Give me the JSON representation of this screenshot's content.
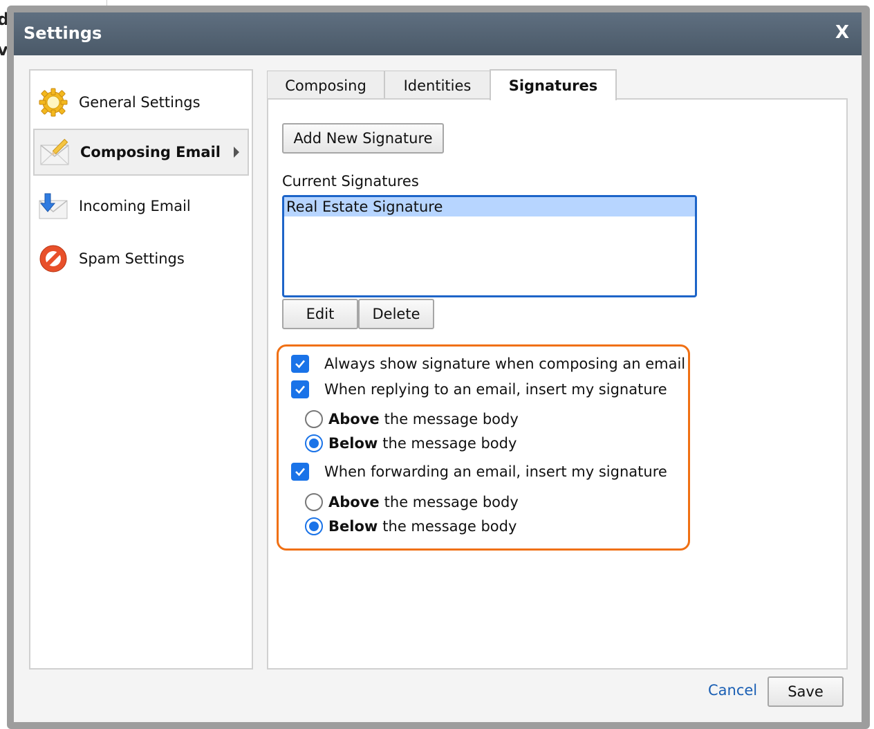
{
  "background": {
    "line1": "da",
    "line2": "vo"
  },
  "dialog": {
    "title": "Settings",
    "close_label": "X"
  },
  "nav": {
    "items": [
      {
        "label": "General Settings",
        "icon": "gear-icon"
      },
      {
        "label": "Composing Email",
        "icon": "envelope-pencil-icon",
        "active": true
      },
      {
        "label": "Incoming Email",
        "icon": "envelope-arrow-icon"
      },
      {
        "label": "Spam Settings",
        "icon": "no-entry-icon"
      }
    ]
  },
  "tabs": [
    {
      "label": "Composing"
    },
    {
      "label": "Identities"
    },
    {
      "label": "Signatures",
      "active": true
    }
  ],
  "signatures": {
    "add_button": "Add New Signature",
    "current_label": "Current Signatures",
    "list": [
      "Real Estate Signature"
    ],
    "edit_button": "Edit",
    "delete_button": "Delete"
  },
  "options": {
    "always_show": {
      "label": "Always show signature when composing an email",
      "checked": true
    },
    "reply": {
      "label": "When replying to an email, insert my signature",
      "checked": true,
      "above_bold": "Above",
      "above_rest": "the message body",
      "below_bold": "Below",
      "below_rest": "the message body",
      "selected": "below"
    },
    "forward": {
      "label": "When forwarding an email, insert my signature",
      "checked": true,
      "above_bold": "Above",
      "above_rest": "the message body",
      "below_bold": "Below",
      "below_rest": "the message body",
      "selected": "below"
    }
  },
  "footer": {
    "cancel_label": "Cancel",
    "save_label": "Save"
  },
  "colors": {
    "accent": "#1a73e8",
    "highlight": "#f07014",
    "titlebar": "#55636f"
  }
}
